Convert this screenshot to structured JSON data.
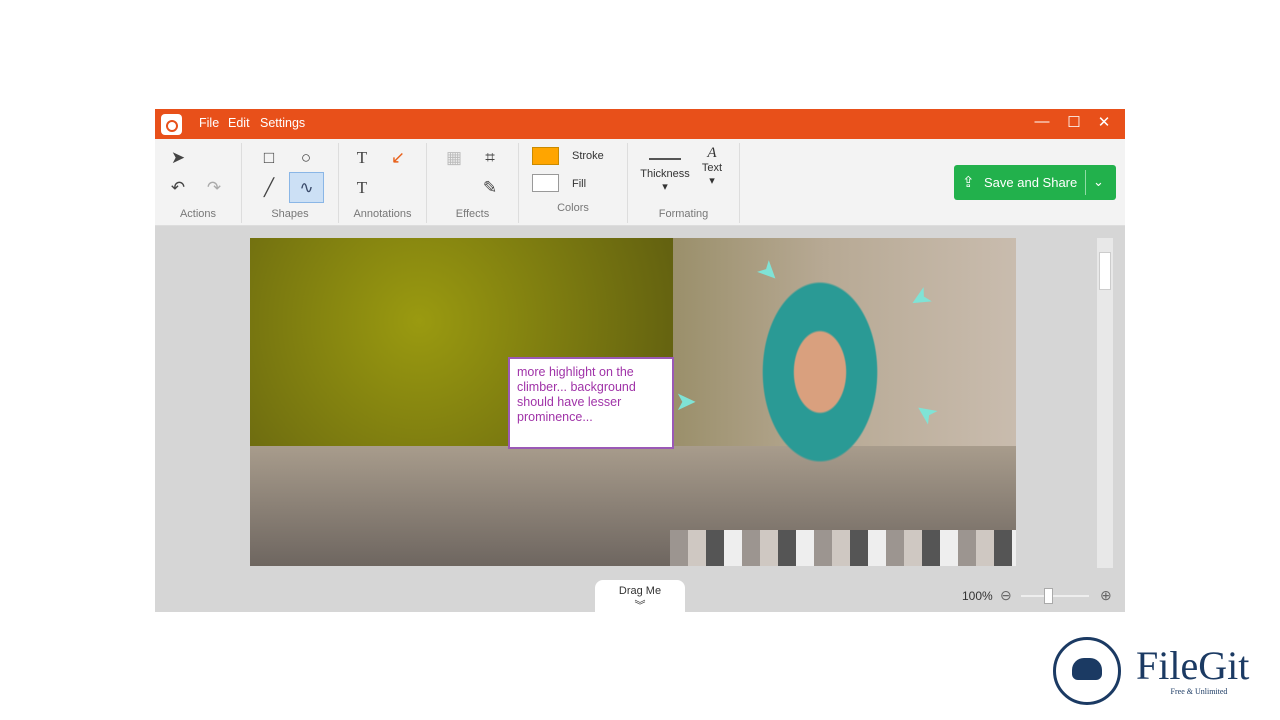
{
  "menu": [
    "File",
    "Edit",
    "Settings"
  ],
  "window_controls": {
    "minimize": "—",
    "maximize": "☐",
    "close": "✕"
  },
  "toolbar": {
    "groups": [
      "Actions",
      "Shapes",
      "Annotations",
      "Effects",
      "Colors",
      "Formating"
    ],
    "stroke_label": "Stroke",
    "fill_label": "Fill",
    "thickness_label": "Thickness",
    "text_label": "Text",
    "stroke_color": "#FFA500",
    "fill_color": "#FFFFFF",
    "save_label": "Save and Share"
  },
  "canvas": {
    "note": "more highlight on the climber... background should have lesser prominence...",
    "arrow_color": "#7fe3d6"
  },
  "footer": {
    "drag_label": "Drag Me",
    "zoom": "100%",
    "zoom_level": 0.5
  },
  "watermark": {
    "name": "FileGit",
    "tagline": "Free & Unlimited"
  },
  "colors": {
    "accent": "#E8501A",
    "save": "#22B14C",
    "note_border": "#9B59B6"
  }
}
